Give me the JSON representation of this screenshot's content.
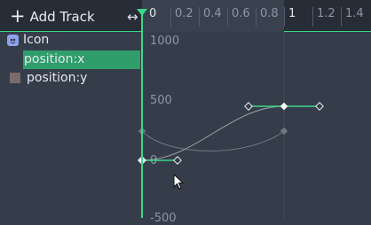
{
  "header": {
    "add_track_label": "Add Track",
    "add_icon": "plus-icon",
    "resize_icon": "horizontal-resize-icon"
  },
  "ruler": {
    "ticks": [
      "0",
      "0.2",
      "0.4",
      "0.6",
      "0.8",
      "1",
      "1.2",
      "1.4"
    ]
  },
  "tracks": {
    "node": {
      "label": "Icon",
      "icon": "node-icon"
    },
    "position_x": {
      "label": "position:x",
      "selected": true
    },
    "position_y": {
      "label": "position:y",
      "color": "#7c6b6b"
    }
  },
  "graph": {
    "value_labels": [
      "1000",
      "500",
      "0",
      "-500"
    ]
  },
  "colors": {
    "accent": "#3ad889",
    "selection": "#2f9e6a",
    "background": "#363d4a",
    "header": "#272c36"
  }
}
